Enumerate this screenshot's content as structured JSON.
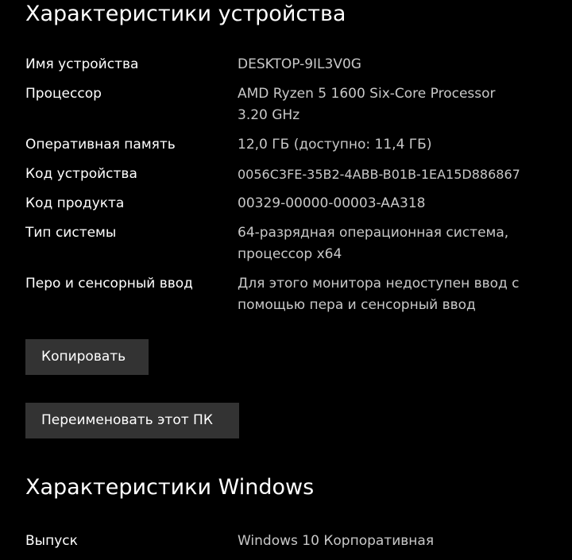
{
  "device_specs": {
    "title": "Характеристики устройства",
    "rows": [
      {
        "label": "Имя устройства",
        "value": "DESKTOP-9IL3V0G"
      },
      {
        "label": "Процессор",
        "value": "AMD Ryzen 5 1600 Six-Core Processor 3.20 GHz"
      },
      {
        "label": "Оперативная память",
        "value": "12,0 ГБ (доступно: 11,4 ГБ)"
      },
      {
        "label": "Код устройства",
        "value": "0056C3FE-35B2-4ABB-B01B-1EA15D886867"
      },
      {
        "label": "Код продукта",
        "value": "00329-00000-00003-AA318"
      },
      {
        "label": "Тип системы",
        "value": "64-разрядная операционная система, процессор x64"
      },
      {
        "label": "Перо и сенсорный ввод",
        "value": "Для этого монитора недоступен ввод с помощью пера и сенсорный ввод"
      }
    ],
    "copy_button_label": "Копировать",
    "rename_button_label": "Переименовать этот ПК"
  },
  "windows_specs": {
    "title": "Характеристики Windows",
    "rows": [
      {
        "label": "Выпуск",
        "value": "Windows 10 Корпоративная"
      }
    ]
  },
  "colors": {
    "background": "#000000",
    "label_text": "#ffffff",
    "value_text": "#c8c8c8",
    "button_background": "#333333"
  }
}
